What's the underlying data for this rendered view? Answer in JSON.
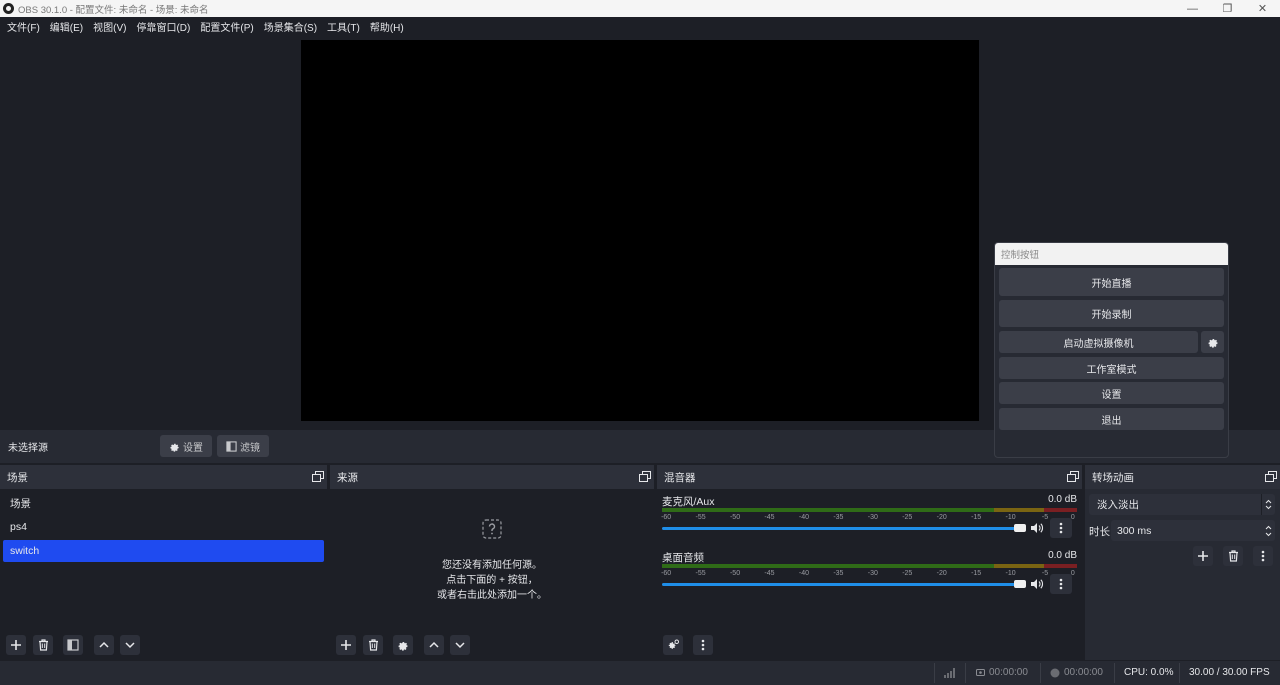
{
  "window": {
    "title": "OBS 30.1.0 - 配置文件: 未命名 - 场景: 未命名",
    "minimize": "—",
    "maximize": "❐",
    "close": "✕"
  },
  "menu": [
    "文件(F)",
    "编辑(E)",
    "视图(V)",
    "停靠窗口(D)",
    "配置文件(P)",
    "场景集合(S)",
    "工具(T)",
    "帮助(H)"
  ],
  "source_toolbar": {
    "no_source": "未选择源",
    "settings": "设置",
    "filters": "滤镜"
  },
  "scenes": {
    "title": "场景",
    "items": [
      "场景",
      "ps4",
      "switch"
    ],
    "selected": "switch"
  },
  "sources": {
    "title": "来源",
    "empty_line1": "您还没有添加任何源。",
    "empty_line2": "点击下面的 + 按钮，",
    "empty_line3": "或者右击此处添加一个。"
  },
  "mixer": {
    "title": "混音器",
    "ticks": [
      "-60",
      "-55",
      "-50",
      "-45",
      "-40",
      "-35",
      "-30",
      "-25",
      "-20",
      "-15",
      "-10",
      "-5",
      "0"
    ],
    "channels": [
      {
        "name": "麦克风/Aux",
        "db": "0.0 dB"
      },
      {
        "name": "桌面音频",
        "db": "0.0 dB"
      }
    ]
  },
  "transitions": {
    "title": "转场动画",
    "selected": "淡入淡出",
    "duration_label": "时长",
    "duration_value": "300 ms"
  },
  "controls": {
    "title": "控制按钮",
    "start_stream": "开始直播",
    "start_record": "开始录制",
    "virtual_cam": "启动虚拟摄像机",
    "studio_mode": "工作室模式",
    "settings": "设置",
    "exit": "退出"
  },
  "status": {
    "stream_time": "00:00:00",
    "record_time": "00:00:00",
    "cpu": "CPU: 0.0%",
    "fps": "30.00 / 30.00 FPS"
  },
  "colors": {
    "bg": "#1d1f26",
    "panel": "#272a33",
    "selection": "#1f4bf0",
    "slider": "#1f8ee8"
  }
}
